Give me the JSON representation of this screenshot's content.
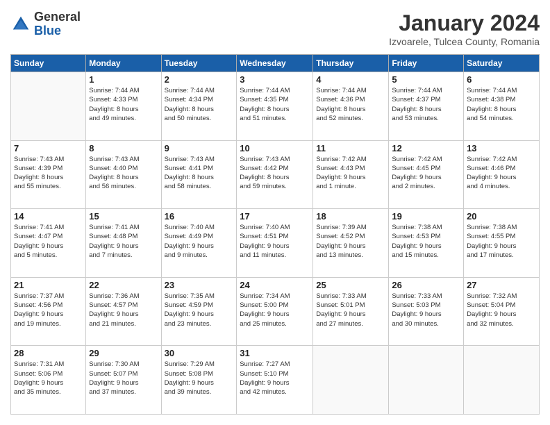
{
  "header": {
    "logo_general": "General",
    "logo_blue": "Blue",
    "month": "January 2024",
    "location": "Izvoarele, Tulcea County, Romania"
  },
  "days_of_week": [
    "Sunday",
    "Monday",
    "Tuesday",
    "Wednesday",
    "Thursday",
    "Friday",
    "Saturday"
  ],
  "weeks": [
    [
      {
        "day": "",
        "info": ""
      },
      {
        "day": "1",
        "info": "Sunrise: 7:44 AM\nSunset: 4:33 PM\nDaylight: 8 hours\nand 49 minutes."
      },
      {
        "day": "2",
        "info": "Sunrise: 7:44 AM\nSunset: 4:34 PM\nDaylight: 8 hours\nand 50 minutes."
      },
      {
        "day": "3",
        "info": "Sunrise: 7:44 AM\nSunset: 4:35 PM\nDaylight: 8 hours\nand 51 minutes."
      },
      {
        "day": "4",
        "info": "Sunrise: 7:44 AM\nSunset: 4:36 PM\nDaylight: 8 hours\nand 52 minutes."
      },
      {
        "day": "5",
        "info": "Sunrise: 7:44 AM\nSunset: 4:37 PM\nDaylight: 8 hours\nand 53 minutes."
      },
      {
        "day": "6",
        "info": "Sunrise: 7:44 AM\nSunset: 4:38 PM\nDaylight: 8 hours\nand 54 minutes."
      }
    ],
    [
      {
        "day": "7",
        "info": "Sunrise: 7:43 AM\nSunset: 4:39 PM\nDaylight: 8 hours\nand 55 minutes."
      },
      {
        "day": "8",
        "info": "Sunrise: 7:43 AM\nSunset: 4:40 PM\nDaylight: 8 hours\nand 56 minutes."
      },
      {
        "day": "9",
        "info": "Sunrise: 7:43 AM\nSunset: 4:41 PM\nDaylight: 8 hours\nand 58 minutes."
      },
      {
        "day": "10",
        "info": "Sunrise: 7:43 AM\nSunset: 4:42 PM\nDaylight: 8 hours\nand 59 minutes."
      },
      {
        "day": "11",
        "info": "Sunrise: 7:42 AM\nSunset: 4:43 PM\nDaylight: 9 hours\nand 1 minute."
      },
      {
        "day": "12",
        "info": "Sunrise: 7:42 AM\nSunset: 4:45 PM\nDaylight: 9 hours\nand 2 minutes."
      },
      {
        "day": "13",
        "info": "Sunrise: 7:42 AM\nSunset: 4:46 PM\nDaylight: 9 hours\nand 4 minutes."
      }
    ],
    [
      {
        "day": "14",
        "info": "Sunrise: 7:41 AM\nSunset: 4:47 PM\nDaylight: 9 hours\nand 5 minutes."
      },
      {
        "day": "15",
        "info": "Sunrise: 7:41 AM\nSunset: 4:48 PM\nDaylight: 9 hours\nand 7 minutes."
      },
      {
        "day": "16",
        "info": "Sunrise: 7:40 AM\nSunset: 4:49 PM\nDaylight: 9 hours\nand 9 minutes."
      },
      {
        "day": "17",
        "info": "Sunrise: 7:40 AM\nSunset: 4:51 PM\nDaylight: 9 hours\nand 11 minutes."
      },
      {
        "day": "18",
        "info": "Sunrise: 7:39 AM\nSunset: 4:52 PM\nDaylight: 9 hours\nand 13 minutes."
      },
      {
        "day": "19",
        "info": "Sunrise: 7:38 AM\nSunset: 4:53 PM\nDaylight: 9 hours\nand 15 minutes."
      },
      {
        "day": "20",
        "info": "Sunrise: 7:38 AM\nSunset: 4:55 PM\nDaylight: 9 hours\nand 17 minutes."
      }
    ],
    [
      {
        "day": "21",
        "info": "Sunrise: 7:37 AM\nSunset: 4:56 PM\nDaylight: 9 hours\nand 19 minutes."
      },
      {
        "day": "22",
        "info": "Sunrise: 7:36 AM\nSunset: 4:57 PM\nDaylight: 9 hours\nand 21 minutes."
      },
      {
        "day": "23",
        "info": "Sunrise: 7:35 AM\nSunset: 4:59 PM\nDaylight: 9 hours\nand 23 minutes."
      },
      {
        "day": "24",
        "info": "Sunrise: 7:34 AM\nSunset: 5:00 PM\nDaylight: 9 hours\nand 25 minutes."
      },
      {
        "day": "25",
        "info": "Sunrise: 7:33 AM\nSunset: 5:01 PM\nDaylight: 9 hours\nand 27 minutes."
      },
      {
        "day": "26",
        "info": "Sunrise: 7:33 AM\nSunset: 5:03 PM\nDaylight: 9 hours\nand 30 minutes."
      },
      {
        "day": "27",
        "info": "Sunrise: 7:32 AM\nSunset: 5:04 PM\nDaylight: 9 hours\nand 32 minutes."
      }
    ],
    [
      {
        "day": "28",
        "info": "Sunrise: 7:31 AM\nSunset: 5:06 PM\nDaylight: 9 hours\nand 35 minutes."
      },
      {
        "day": "29",
        "info": "Sunrise: 7:30 AM\nSunset: 5:07 PM\nDaylight: 9 hours\nand 37 minutes."
      },
      {
        "day": "30",
        "info": "Sunrise: 7:29 AM\nSunset: 5:08 PM\nDaylight: 9 hours\nand 39 minutes."
      },
      {
        "day": "31",
        "info": "Sunrise: 7:27 AM\nSunset: 5:10 PM\nDaylight: 9 hours\nand 42 minutes."
      },
      {
        "day": "",
        "info": ""
      },
      {
        "day": "",
        "info": ""
      },
      {
        "day": "",
        "info": ""
      }
    ]
  ]
}
